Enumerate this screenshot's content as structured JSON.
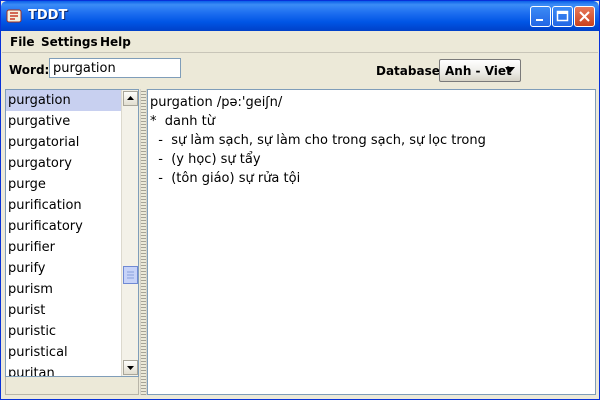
{
  "window": {
    "title": "TDDT",
    "app_icon": "dictionary-app-icon"
  },
  "menubar": {
    "items": [
      "File",
      "Settings",
      "Help"
    ]
  },
  "toolbar": {
    "word_label": "Word:",
    "word_value": "purgation",
    "database_label": "Database:",
    "database_value": "Anh - Viet"
  },
  "wordlist": {
    "items": [
      "purgation",
      "purgative",
      "purgatorial",
      "purgatory",
      "purge",
      "purification",
      "purificatory",
      "purifier",
      "purify",
      "purism",
      "purist",
      "puristic",
      "puristical",
      "puritan"
    ],
    "selected_index": 0
  },
  "definition": {
    "lines": [
      "purgation /pə:'geiʃn/",
      "*  danh từ",
      "  -  sự làm sạch, sự làm cho trong sạch, sự lọc trong",
      "  -  (y học) sự tẩy",
      "  -  (tôn giáo) sự rửa tội"
    ]
  },
  "colors": {
    "titlebar": "#0055e5",
    "selection": "#c8d0f0",
    "border": "#7f9db9"
  }
}
